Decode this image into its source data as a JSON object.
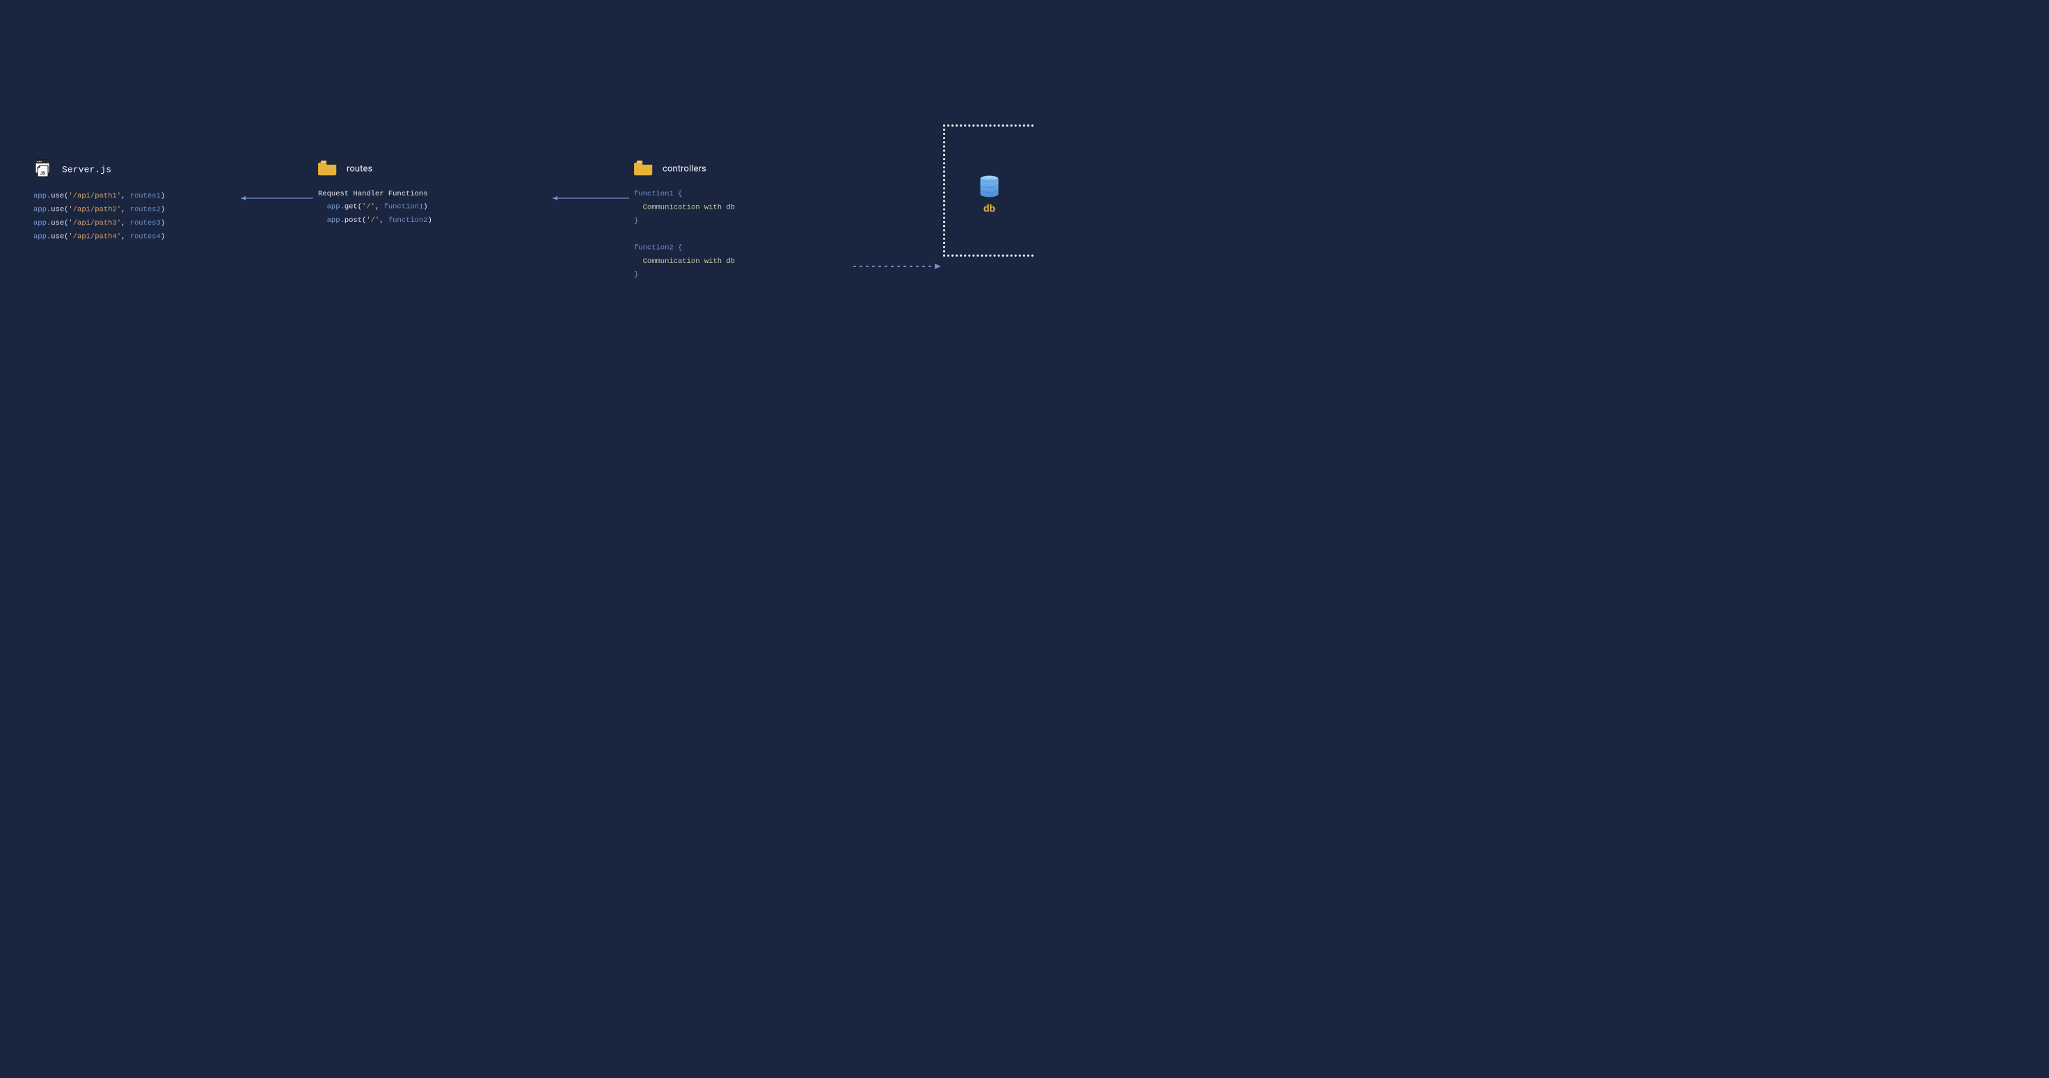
{
  "server": {
    "title": "Server.js",
    "lines": [
      {
        "app": "app",
        "fn": "use",
        "str": "'/api/path1'",
        "ident": "routes1"
      },
      {
        "app": "app",
        "fn": "use",
        "str": "'/api/path2'",
        "ident": "routes2"
      },
      {
        "app": "app",
        "fn": "use",
        "str": "'/api/path3'",
        "ident": "routes3"
      },
      {
        "app": "app",
        "fn": "use",
        "str": "'/api/path4'",
        "ident": "routes4"
      }
    ]
  },
  "routes": {
    "title": "routes",
    "header": "Request Handler Functions",
    "lines": [
      {
        "app": "app",
        "fn": "get",
        "str": "'/'",
        "ident": "function1"
      },
      {
        "app": "app",
        "fn": "post",
        "str": "'/'",
        "ident": "function2"
      }
    ]
  },
  "controllers": {
    "title": "controllers",
    "functions": [
      {
        "name": "function1",
        "body": "Communication with db"
      },
      {
        "name": "function2",
        "body": "Communication with db"
      }
    ]
  },
  "db": {
    "label": "db"
  },
  "punct": {
    "dot": ".",
    "open": "(",
    "close": ")",
    "comma_sp": ", ",
    "sp_obrace": " {",
    "cbrace": "}"
  }
}
